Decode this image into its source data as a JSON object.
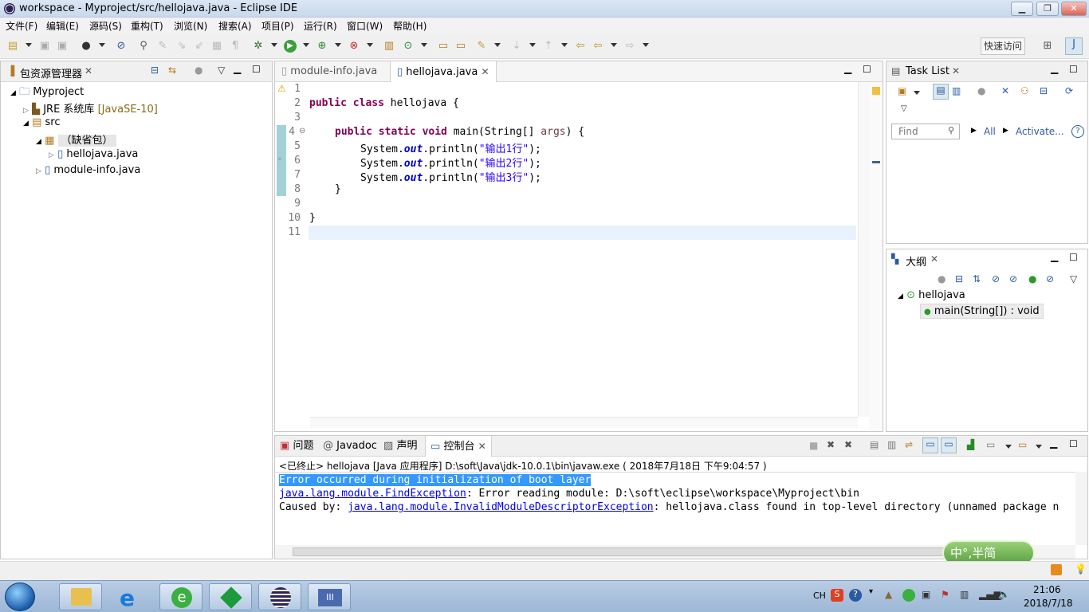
{
  "window": {
    "title": "workspace - Myproject/src/hellojava.java - Eclipse IDE"
  },
  "menu": [
    "文件(F)",
    "编辑(E)",
    "源码(S)",
    "重构(T)",
    "浏览(N)",
    "搜索(A)",
    "项目(P)",
    "运行(R)",
    "窗口(W)",
    "帮助(H)"
  ],
  "quick_access": "快速访问",
  "package_explorer": {
    "title": "包资源管理器",
    "project": "Myproject",
    "jre": "JRE 系统库",
    "jre_version": "[JavaSE-10]",
    "src": "src",
    "default_pkg": "（缺省包）",
    "file1": "hellojava.java",
    "file2": "module-info.java"
  },
  "editor": {
    "tabs": [
      "module-info.java",
      "hellojava.java"
    ],
    "line_numbers": [
      "1",
      "2",
      "3",
      "4",
      "5",
      "6",
      "7",
      "8",
      "9",
      "10",
      "11"
    ]
  },
  "code": {
    "l2_kw": "public class ",
    "l2_rest": "hellojava {",
    "l4_kw": "public static void ",
    "l4_rest": "main(String[] ",
    "l4_param": "args",
    "l4_end": ") {",
    "sys": "System.",
    "out": "out",
    "println": ".println(",
    "s1": "\"输出1行\"",
    "s2": "\"输出2行\"",
    "s3": "\"输出3行\"",
    "end": ");",
    "l8": "}",
    "l10": "}"
  },
  "task_list": {
    "title": "Task List",
    "find_placeholder": "Find",
    "all": "All",
    "activate": "Activate..."
  },
  "outline": {
    "title": "大纲",
    "class_name": "hellojava",
    "method": "main(String[]) : void"
  },
  "bottom_tabs": [
    "问题",
    "Javadoc",
    "声明",
    "控制台"
  ],
  "console": {
    "status": "<已终止> hellojava [Java 应用程序] D:\\soft\\Java\\jdk-10.0.1\\bin\\javaw.exe ( 2018年7月18日 下午9:04:57 )",
    "line1": "Error occurred during initialization of boot layer",
    "line2_link": "java.lang.module.FindException",
    "line2_rest": ": Error reading module: D:\\soft\\eclipse\\workspace\\Myproject\\bin",
    "line3_prefix": "Caused by: ",
    "line3_link": "java.lang.module.InvalidModuleDescriptorException",
    "line3_rest": ": hellojava.class found in top-level directory (unnamed package n"
  },
  "ime": "中°,半简",
  "tray": {
    "lang": "CH",
    "time": "21:06",
    "date": "2018/7/18"
  },
  "colors": {
    "keyword": "#7f0055",
    "string": "#2a00ff",
    "link": "#0000ee",
    "selection": "#3399ff"
  }
}
